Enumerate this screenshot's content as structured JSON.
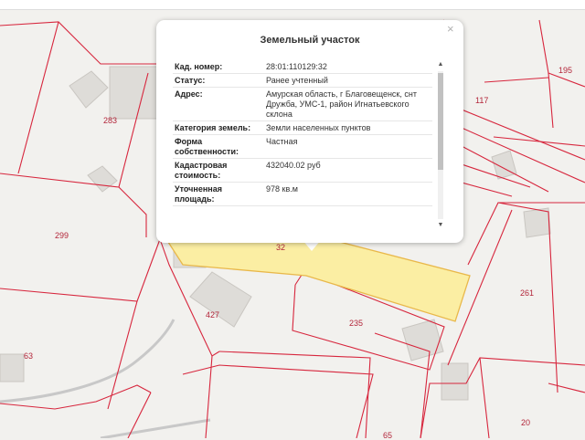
{
  "map": {
    "parcel_labels": [
      "283",
      "299",
      "427",
      "63",
      "235",
      "65",
      "20",
      "261",
      "117",
      "195",
      "32"
    ]
  },
  "popup": {
    "title": "Земельный участок",
    "close_symbol": "×",
    "rows": [
      {
        "key": "Кад. номер:",
        "value": "28:01:110129:32"
      },
      {
        "key": "Статус:",
        "value": "Ранее учтенный"
      },
      {
        "key": "Адрес:",
        "value": "Амурская область, г Благовещенск, снт Дружба, УМС-1, район Игнатьевского склона"
      },
      {
        "key": "Категория земель:",
        "value": "Земли населенных пунктов"
      },
      {
        "key": "Форма собственности:",
        "value": "Частная"
      },
      {
        "key": "Кадастровая стоимость:",
        "value": "432040.02 руб"
      },
      {
        "key": "Уточненная площадь:",
        "value": "978 кв.м"
      }
    ],
    "scroll_up": "▲",
    "scroll_down": "▼"
  },
  "colors": {
    "boundary": "#d7263d",
    "selected_fill": "#fbeea3",
    "selected_stroke": "#e9b84a",
    "building": "#dedcd8",
    "road": "#c8c8c8"
  }
}
